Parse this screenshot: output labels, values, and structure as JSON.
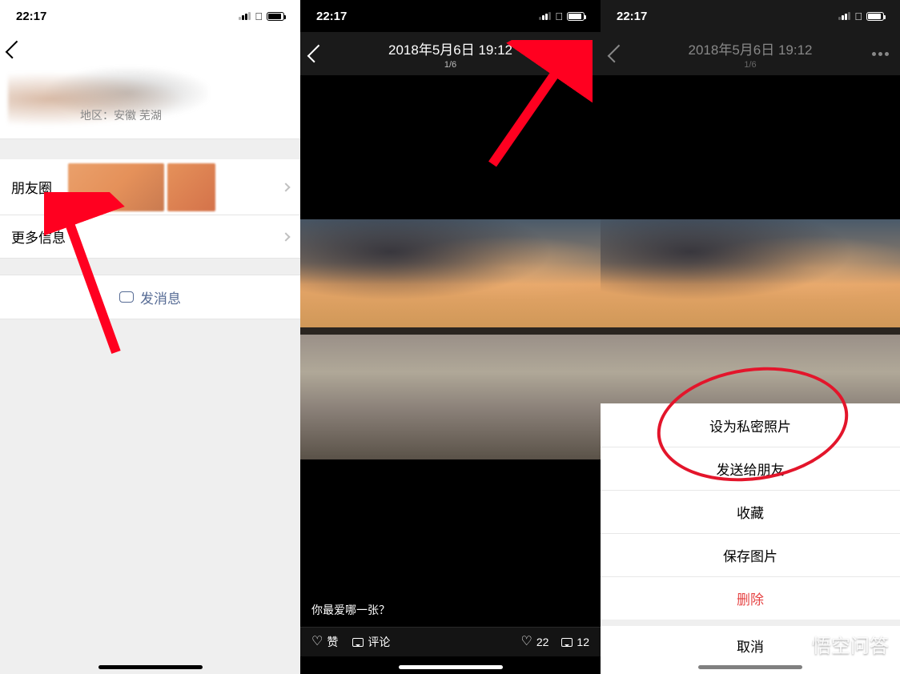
{
  "statusbar": {
    "time": "22:17"
  },
  "panel1": {
    "profile_region": "地区：安徽 芜湖",
    "row_moments": "朋友圈",
    "row_more": "更多信息",
    "send_message": "发消息"
  },
  "panel2": {
    "title": "2018年5月6日 19:12",
    "counter": "1/6",
    "caption": "你最爱哪一张？",
    "like_label": "赞",
    "comment_label": "评论",
    "like_count": "22",
    "comment_count": "12"
  },
  "panel3": {
    "title": "2018年5月6日 19:12",
    "counter": "1/6",
    "sheet": {
      "set_private": "设为私密照片",
      "send_friend": "发送给朋友",
      "favorite": "收藏",
      "save_image": "保存图片",
      "delete": "删除",
      "cancel": "取消"
    }
  },
  "watermark": "悟空问答"
}
